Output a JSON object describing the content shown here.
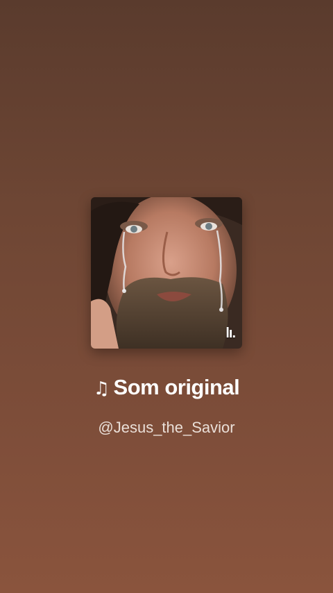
{
  "cover": {
    "icon": "jesus-crying-artwork",
    "badge_text": "lı."
  },
  "sound": {
    "note_icon": "♫",
    "title": "Som original",
    "author": "@Jesus_the_Savior"
  },
  "colors": {
    "background_top": "#5a3b2d",
    "background_bottom": "#8a543d",
    "title": "#ffffff",
    "author": "#eadfd8"
  }
}
